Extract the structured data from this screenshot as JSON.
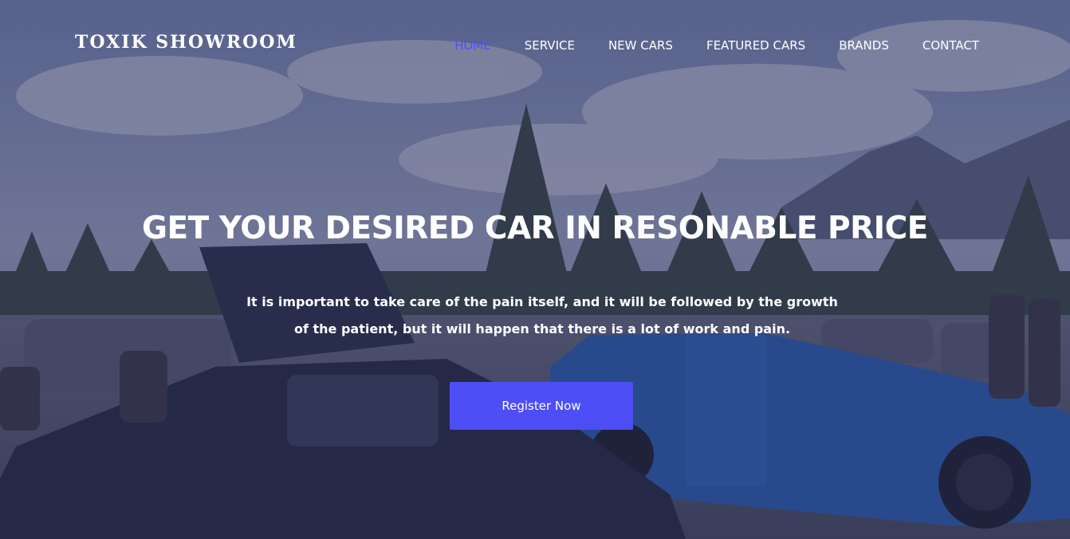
{
  "header": {
    "brand": "TOXIK SHOWROOM",
    "nav": [
      {
        "label": "HOME",
        "active": true
      },
      {
        "label": "SERVICE",
        "active": false
      },
      {
        "label": "NEW CARS",
        "active": false
      },
      {
        "label": "FEATURED CARS",
        "active": false
      },
      {
        "label": "BRANDS",
        "active": false
      },
      {
        "label": "CONTACT",
        "active": false
      }
    ]
  },
  "hero": {
    "headline": "GET YOUR DESIRED CAR IN RESONABLE PRICE",
    "subtext": "It is important to take care of the pain itself, and it will be followed by the growth of the patient, but it will happen that there is a lot of work and pain.",
    "cta_label": "Register Now",
    "background_image": "car-meet-parking-lot-with-mountains"
  },
  "colors": {
    "accent": "#4d4ef5",
    "nav_active": "#4f4ff7",
    "text": "#ffffff",
    "overlay": "#282a58"
  }
}
